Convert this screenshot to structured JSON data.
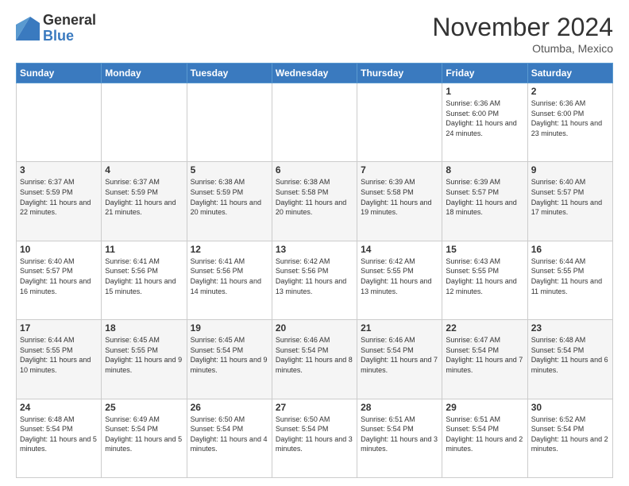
{
  "logo": {
    "general": "General",
    "blue": "Blue"
  },
  "header": {
    "month": "November 2024",
    "location": "Otumba, Mexico"
  },
  "days_of_week": [
    "Sunday",
    "Monday",
    "Tuesday",
    "Wednesday",
    "Thursday",
    "Friday",
    "Saturday"
  ],
  "weeks": [
    [
      {
        "day": "",
        "content": ""
      },
      {
        "day": "",
        "content": ""
      },
      {
        "day": "",
        "content": ""
      },
      {
        "day": "",
        "content": ""
      },
      {
        "day": "",
        "content": ""
      },
      {
        "day": "1",
        "content": "Sunrise: 6:36 AM\nSunset: 6:00 PM\nDaylight: 11 hours and 24 minutes."
      },
      {
        "day": "2",
        "content": "Sunrise: 6:36 AM\nSunset: 6:00 PM\nDaylight: 11 hours and 23 minutes."
      }
    ],
    [
      {
        "day": "3",
        "content": "Sunrise: 6:37 AM\nSunset: 5:59 PM\nDaylight: 11 hours and 22 minutes."
      },
      {
        "day": "4",
        "content": "Sunrise: 6:37 AM\nSunset: 5:59 PM\nDaylight: 11 hours and 21 minutes."
      },
      {
        "day": "5",
        "content": "Sunrise: 6:38 AM\nSunset: 5:59 PM\nDaylight: 11 hours and 20 minutes."
      },
      {
        "day": "6",
        "content": "Sunrise: 6:38 AM\nSunset: 5:58 PM\nDaylight: 11 hours and 20 minutes."
      },
      {
        "day": "7",
        "content": "Sunrise: 6:39 AM\nSunset: 5:58 PM\nDaylight: 11 hours and 19 minutes."
      },
      {
        "day": "8",
        "content": "Sunrise: 6:39 AM\nSunset: 5:57 PM\nDaylight: 11 hours and 18 minutes."
      },
      {
        "day": "9",
        "content": "Sunrise: 6:40 AM\nSunset: 5:57 PM\nDaylight: 11 hours and 17 minutes."
      }
    ],
    [
      {
        "day": "10",
        "content": "Sunrise: 6:40 AM\nSunset: 5:57 PM\nDaylight: 11 hours and 16 minutes."
      },
      {
        "day": "11",
        "content": "Sunrise: 6:41 AM\nSunset: 5:56 PM\nDaylight: 11 hours and 15 minutes."
      },
      {
        "day": "12",
        "content": "Sunrise: 6:41 AM\nSunset: 5:56 PM\nDaylight: 11 hours and 14 minutes."
      },
      {
        "day": "13",
        "content": "Sunrise: 6:42 AM\nSunset: 5:56 PM\nDaylight: 11 hours and 13 minutes."
      },
      {
        "day": "14",
        "content": "Sunrise: 6:42 AM\nSunset: 5:55 PM\nDaylight: 11 hours and 13 minutes."
      },
      {
        "day": "15",
        "content": "Sunrise: 6:43 AM\nSunset: 5:55 PM\nDaylight: 11 hours and 12 minutes."
      },
      {
        "day": "16",
        "content": "Sunrise: 6:44 AM\nSunset: 5:55 PM\nDaylight: 11 hours and 11 minutes."
      }
    ],
    [
      {
        "day": "17",
        "content": "Sunrise: 6:44 AM\nSunset: 5:55 PM\nDaylight: 11 hours and 10 minutes."
      },
      {
        "day": "18",
        "content": "Sunrise: 6:45 AM\nSunset: 5:55 PM\nDaylight: 11 hours and 9 minutes."
      },
      {
        "day": "19",
        "content": "Sunrise: 6:45 AM\nSunset: 5:54 PM\nDaylight: 11 hours and 9 minutes."
      },
      {
        "day": "20",
        "content": "Sunrise: 6:46 AM\nSunset: 5:54 PM\nDaylight: 11 hours and 8 minutes."
      },
      {
        "day": "21",
        "content": "Sunrise: 6:46 AM\nSunset: 5:54 PM\nDaylight: 11 hours and 7 minutes."
      },
      {
        "day": "22",
        "content": "Sunrise: 6:47 AM\nSunset: 5:54 PM\nDaylight: 11 hours and 7 minutes."
      },
      {
        "day": "23",
        "content": "Sunrise: 6:48 AM\nSunset: 5:54 PM\nDaylight: 11 hours and 6 minutes."
      }
    ],
    [
      {
        "day": "24",
        "content": "Sunrise: 6:48 AM\nSunset: 5:54 PM\nDaylight: 11 hours and 5 minutes."
      },
      {
        "day": "25",
        "content": "Sunrise: 6:49 AM\nSunset: 5:54 PM\nDaylight: 11 hours and 5 minutes."
      },
      {
        "day": "26",
        "content": "Sunrise: 6:50 AM\nSunset: 5:54 PM\nDaylight: 11 hours and 4 minutes."
      },
      {
        "day": "27",
        "content": "Sunrise: 6:50 AM\nSunset: 5:54 PM\nDaylight: 11 hours and 3 minutes."
      },
      {
        "day": "28",
        "content": "Sunrise: 6:51 AM\nSunset: 5:54 PM\nDaylight: 11 hours and 3 minutes."
      },
      {
        "day": "29",
        "content": "Sunrise: 6:51 AM\nSunset: 5:54 PM\nDaylight: 11 hours and 2 minutes."
      },
      {
        "day": "30",
        "content": "Sunrise: 6:52 AM\nSunset: 5:54 PM\nDaylight: 11 hours and 2 minutes."
      }
    ]
  ]
}
